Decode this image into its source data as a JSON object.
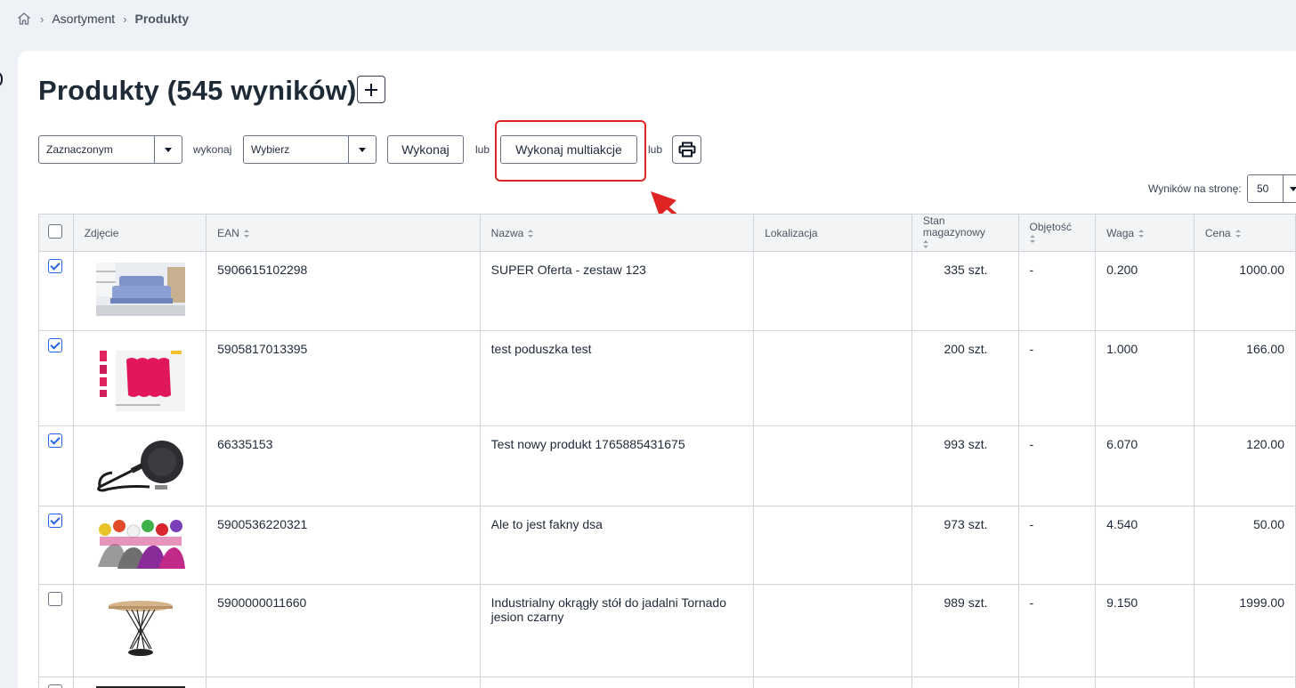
{
  "breadcrumb": {
    "items": [
      "Asortyment",
      "Produkty"
    ]
  },
  "page": {
    "title": "Produkty (545 wyników)"
  },
  "toolbar": {
    "target_select": "Zaznaczonym",
    "perform_label": "wykonaj",
    "action_select": "Wybierz",
    "execute_button": "Wykonaj",
    "or_label_1": "lub",
    "multi_button": "Wykonaj multiakcje",
    "or_label_2": "lub"
  },
  "pagination": {
    "per_page_label": "Wyników na stronę:",
    "per_page_value": "50"
  },
  "table": {
    "headers": {
      "photo": "Zdjęcie",
      "ean": "EAN",
      "name": "Nazwa",
      "location": "Lokalizacja",
      "stock": "Stan magazynowy",
      "volume": "Objętość",
      "weight": "Waga",
      "price": "Cena"
    },
    "rows": [
      {
        "checked": true,
        "image": "sofa-image",
        "ean": "5906615102298",
        "name": "SUPER Oferta - zestaw 123",
        "location": "",
        "stock": "335 szt.",
        "volume": "-",
        "weight": "0.200",
        "price": "1000.00"
      },
      {
        "checked": true,
        "image": "pillow-image",
        "ean": "5905817013395",
        "name": "test poduszka test",
        "location": "",
        "stock": "200 szt.",
        "volume": "-",
        "weight": "1.000",
        "price": "166.00"
      },
      {
        "checked": true,
        "image": "leash-image",
        "ean": "66335153",
        "name": "Test nowy produkt 1765885431675",
        "location": "",
        "stock": "993 szt.",
        "volume": "-",
        "weight": "6.070",
        "price": "120.00"
      },
      {
        "checked": true,
        "image": "knit-hats-image",
        "ean": "5900536220321",
        "name": "Ale to jest fakny dsa",
        "location": "",
        "stock": "973 szt.",
        "volume": "-",
        "weight": "4.540",
        "price": "50.00"
      },
      {
        "checked": false,
        "image": "round-table-image",
        "ean": "5900000011660",
        "name": "Industrialny okrągły stół do jadalni Tornado jesion czarny",
        "location": "",
        "stock": "989 szt.",
        "volume": "-",
        "weight": "9.150",
        "price": "1999.00"
      }
    ]
  },
  "colors": {
    "annotation": "#e02424",
    "checkbox": "#2563eb"
  }
}
